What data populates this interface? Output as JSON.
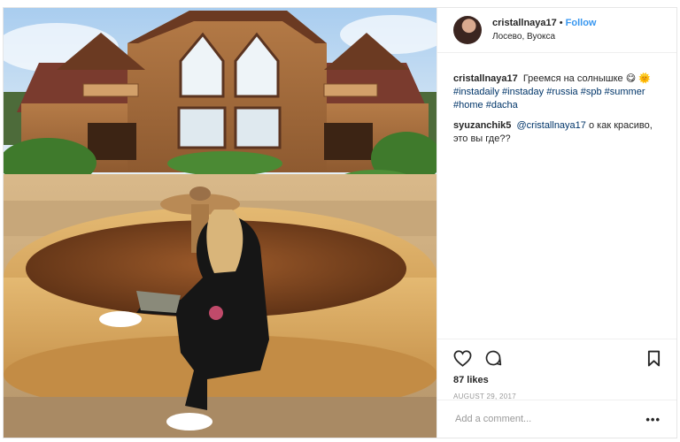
{
  "post": {
    "author": {
      "username": "cristallnaya17",
      "follow_label": "Follow",
      "separator": "•",
      "location": "Лосево, Вуокса"
    },
    "caption": {
      "username": "cristallnaya17",
      "text": "Греемся на солнышке",
      "emojis": "😋 🌞",
      "hashtags": [
        "#instadaily",
        "#instaday",
        "#russia",
        "#spb",
        "#summer",
        "#home",
        "#dacha"
      ]
    },
    "comments": [
      {
        "username": "syuzanchik5",
        "mention": "@cristallnaya17",
        "text": "о как красиво, это вы где??"
      }
    ],
    "likes": "87 likes",
    "date": "AUGUST 29, 2017",
    "add_comment_placeholder": "Add a comment...",
    "more_label": "•••"
  },
  "icons": {
    "like": "heart-outline-icon",
    "comment": "speech-bubble-icon",
    "save": "bookmark-icon",
    "more": "ellipsis-icon"
  }
}
